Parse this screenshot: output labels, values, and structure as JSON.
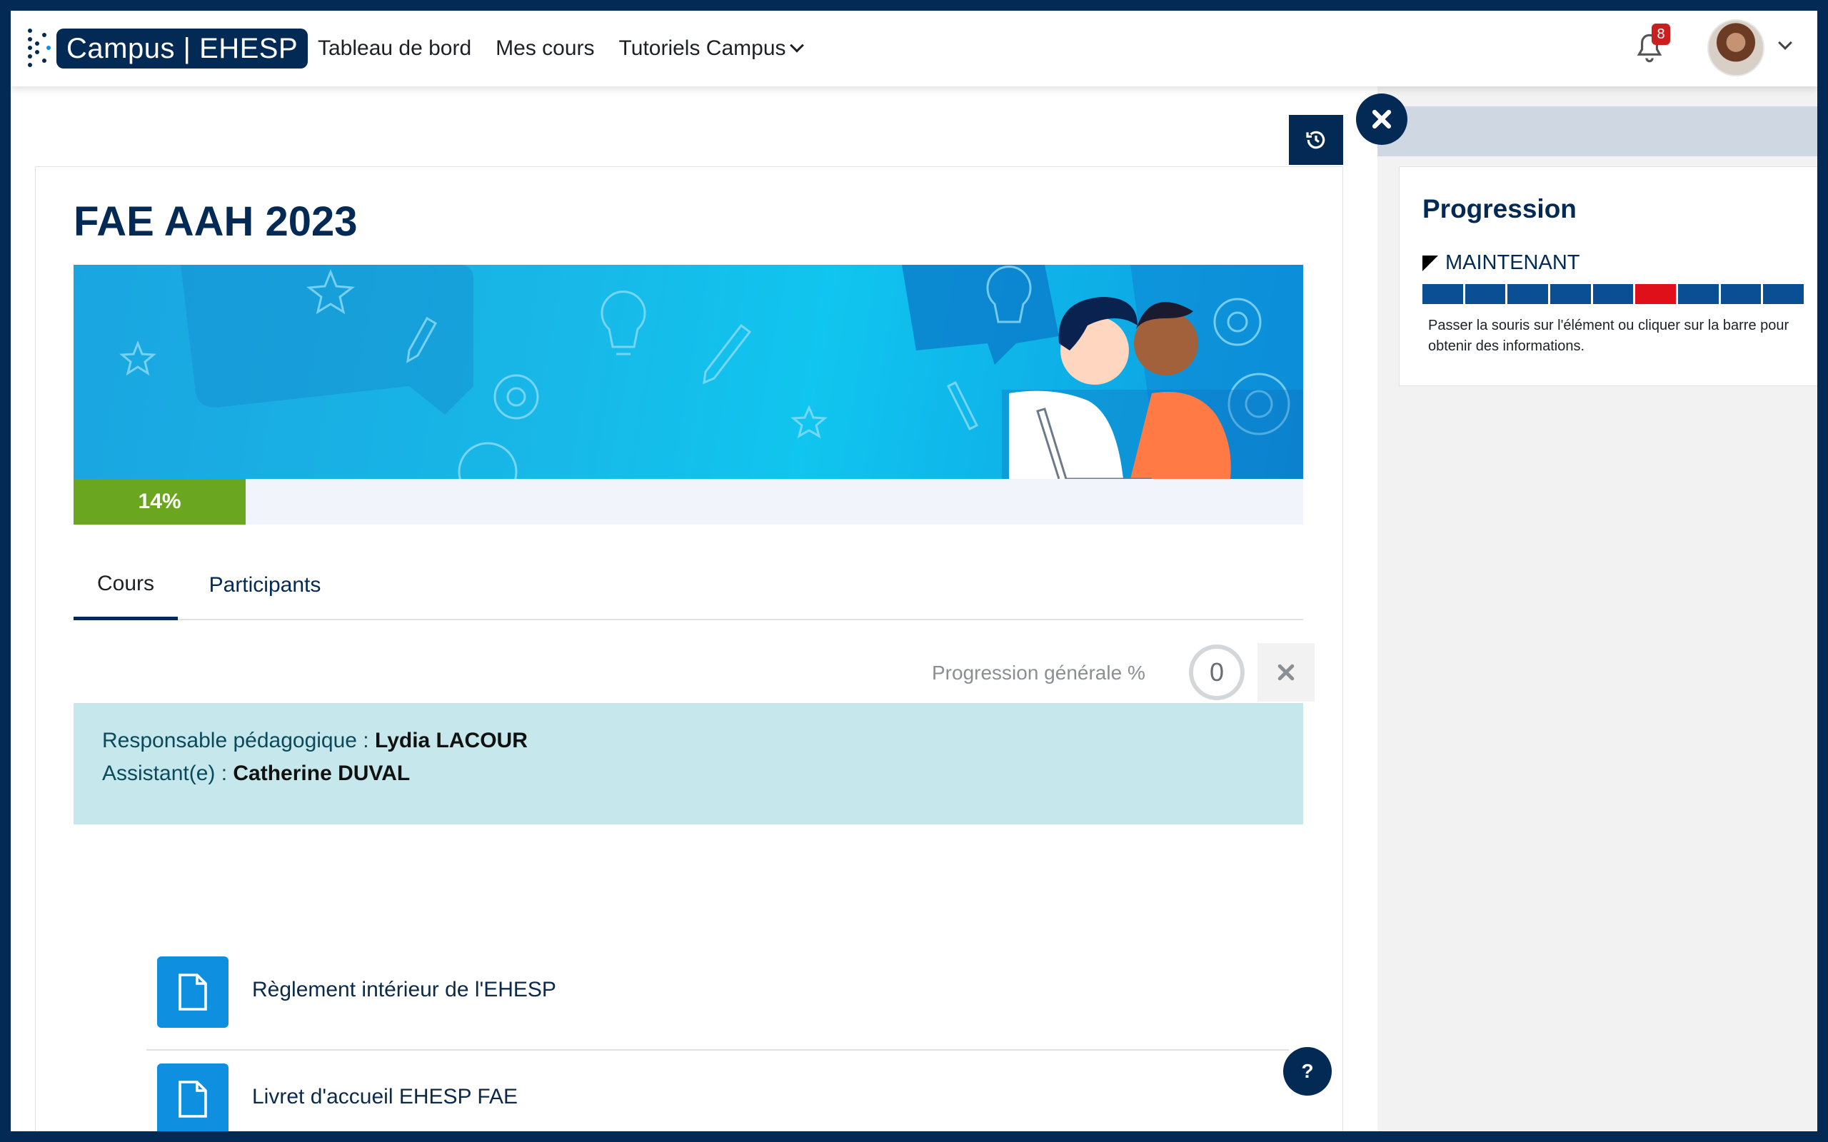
{
  "brand": {
    "logo_text": "Campus | EHESP"
  },
  "nav": {
    "links": [
      "Tableau de bord",
      "Mes cours",
      "Tutoriels Campus"
    ],
    "notifications_count": "8"
  },
  "course": {
    "title": "FAE AAH 2023",
    "progress_label": "14%",
    "progress_value": 14
  },
  "tabs": [
    "Cours",
    "Participants"
  ],
  "overall_progress": {
    "label": "Progression générale %",
    "value": "0"
  },
  "info": {
    "responsable_label": "Responsable pédagogique : ",
    "responsable_name": "Lydia LACOUR",
    "assistant_label": "Assistant(e) : ",
    "assistant_name": "Catherine DUVAL"
  },
  "activities": [
    "Règlement intérieur de l'EHESP",
    "Livret d'accueil EHESP FAE"
  ],
  "help_label": "?",
  "progress_block": {
    "title": "Progression",
    "now_label": "MAINTENANT",
    "segments_total": 9,
    "current_segment": 6,
    "hint": "Passer la souris sur l'élément ou cliquer sur la barre pour obtenir des informations."
  },
  "colors": {
    "brand_navy": "#022a55",
    "progress_green": "#6aa61f",
    "segment_blue": "#0a4f94",
    "segment_current": "#e0101b",
    "info_bg": "#c6e8ec"
  }
}
